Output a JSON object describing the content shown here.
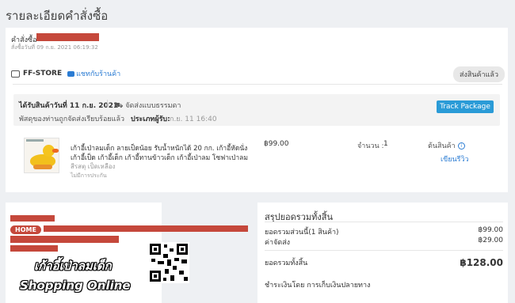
{
  "page_title": "รายละเอียดคำสั่งซื้อ",
  "order": {
    "order_label": "คำสั่งซื้อ",
    "order_date": "สั่งซื้อวันที่ 09 ก.ย. 2021 06:19:32"
  },
  "store": {
    "name": "FF-STORE",
    "chat_label": "แชทกับร้านค้า",
    "status_badge": "ส่งสินค้าแล้ว"
  },
  "shipping": {
    "received_text": "ได้รับสินค้าวันที่ 11 ก.ย. 2021",
    "ship_method": "จัดส่งแบบธรรมดา",
    "parcel_text": "พัสดุของท่านถูกจัดส่งเรียบร้อยแล้ว",
    "recipient_label": "ประเภทผู้รับ:",
    "recipient_value": "ก.ย. 11 16:40",
    "track_button": "Track Package"
  },
  "product": {
    "name_line1": "เก้าอี้เป่าลมเด็ก ลายเป็ดน้อย รับน้ำหนักได้ 20 กก. เก้าอี้หัดนั่ง",
    "name_line2": "เก้าอี้เป็ด เก้าอี้เด็ก เก้าอี้ทานข้าวเด็ก เก้าอี้เป่าลม โซฟาเป่าลม",
    "variant": "สีรสตุ เป็ดเหลือง",
    "non_returnable": "ไม่มีการประกัน",
    "price": "฿99.00",
    "quantity_label": "จำนวน :",
    "quantity": "1",
    "status_label": "ต้นสินค้า",
    "review_link": "เขียนรีวิว"
  },
  "address": {
    "home_badge": "HOME"
  },
  "promo": {
    "line1": "เก้าอี้เป่าลมเด็ก",
    "line2": "Shopping Online"
  },
  "summary": {
    "title": "สรุปยอดรวมทั้งสิ้น",
    "subtotal_label": "ยอดรวมส่วนนี้(1 สินค้า)",
    "subtotal_value": "฿99.00",
    "shipping_label": "ค่าจัดส่ง",
    "shipping_value": "฿29.00",
    "total_label": "ยอดรวมทั้งสิ้น",
    "total_value": "฿128.00",
    "payment_text": "ชำระเงินโดย การเก็บเงินปลายทาง"
  }
}
